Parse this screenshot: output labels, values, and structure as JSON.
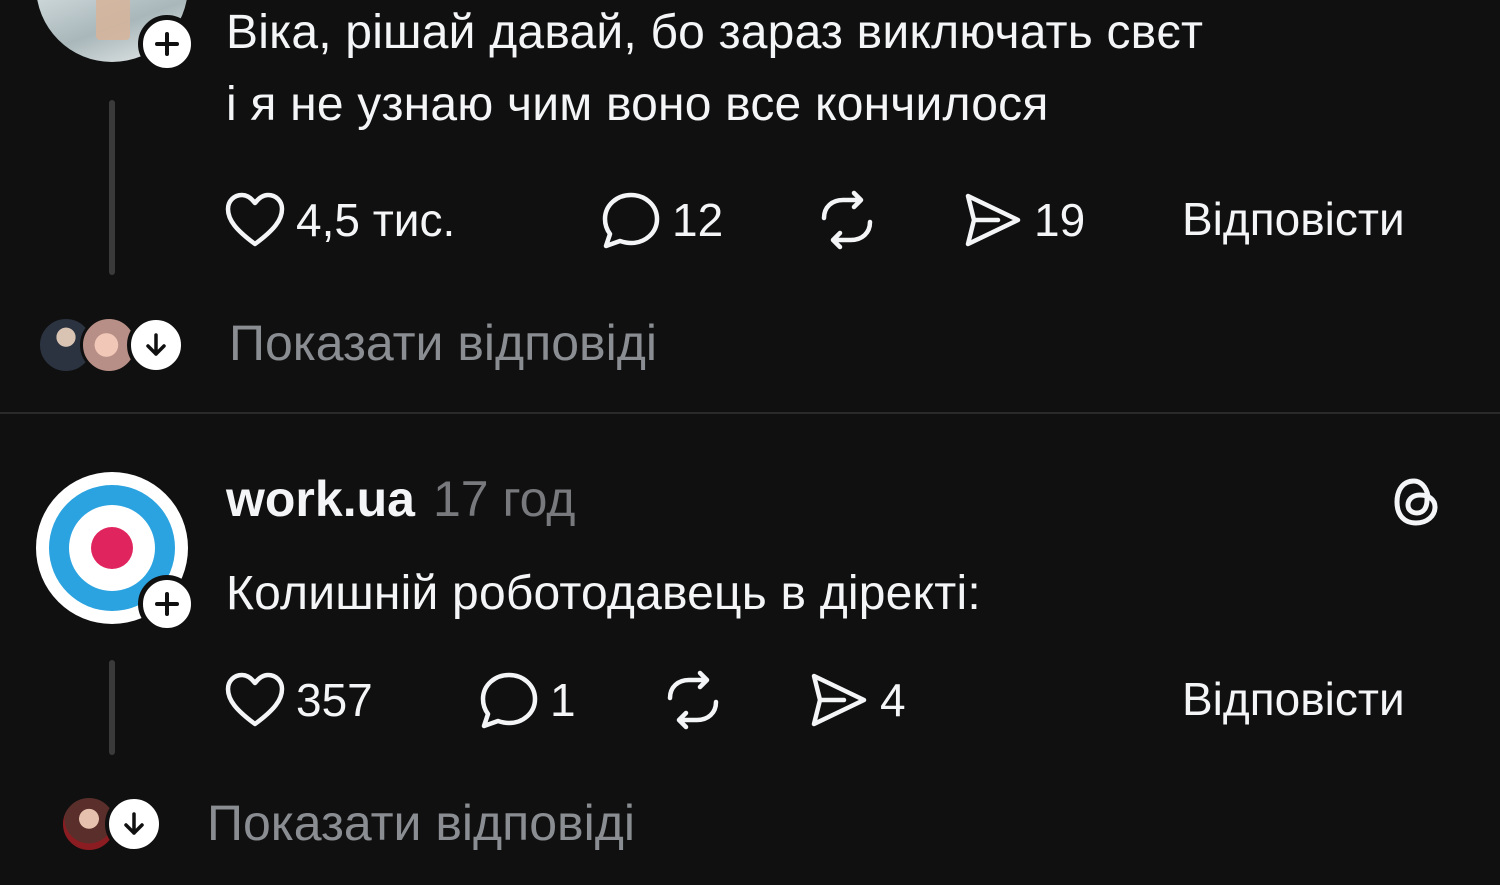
{
  "post1": {
    "text": "Віка, рішай давай, бо зараз виключать свєт\nі я не узнаю чим воно все кончилося",
    "likes": "4,5 тис.",
    "comments": "12",
    "shares": "19",
    "reply_label": "Відповісти",
    "show_replies_label": "Показати відповіді"
  },
  "post2": {
    "username": "work.ua",
    "timestamp": "17 год",
    "text": "Колишній роботодавець в діректі:",
    "likes": "357",
    "comments": "1",
    "shares": "4",
    "reply_label": "Відповісти",
    "show_replies_label": "Показати відповіді",
    "brand_colors": {
      "ring": "#2aa3e0",
      "dot": "#e0245e"
    }
  },
  "icons": {
    "like": "heart-icon",
    "comment": "comment-bubble-icon",
    "repost": "repost-icon",
    "share": "send-icon",
    "follow": "plus-icon",
    "expand": "arrow-down-icon",
    "threads": "threads-logo-icon"
  }
}
